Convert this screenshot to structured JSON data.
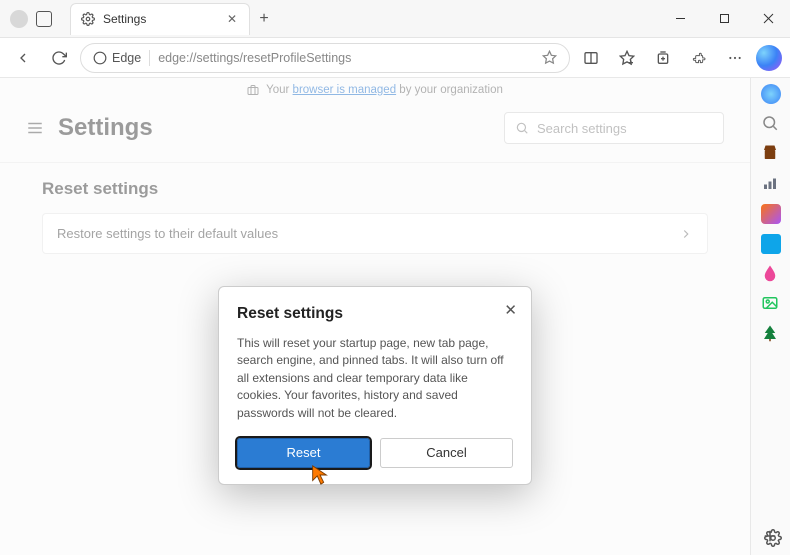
{
  "titlebar": {
    "tab_title": "Settings",
    "newtab_tooltip": "New tab"
  },
  "toolbar": {
    "edge_label": "Edge",
    "url": "edge://settings/resetProfileSettings"
  },
  "managed": {
    "prefix": "Your ",
    "link": "browser is managed",
    "suffix": " by your organization"
  },
  "settings": {
    "title": "Settings",
    "search_placeholder": "Search settings",
    "section_title": "Reset settings",
    "row_label": "Restore settings to their default values"
  },
  "dialog": {
    "title": "Reset settings",
    "body": "This will reset your startup page, new tab page, search engine, and pinned tabs. It will also turn off all extensions and clear temporary data like cookies. Your favorites, history and saved passwords will not be cleared.",
    "reset": "Reset",
    "cancel": "Cancel"
  },
  "sidebar_icons": [
    {
      "name": "copilot-ico",
      "color": "#3b82f6"
    },
    {
      "name": "wand-ico",
      "color": "#a855f7"
    },
    {
      "name": "shopping-ico",
      "color": "#7c3e10"
    },
    {
      "name": "games-ico",
      "color": "#6b7280"
    },
    {
      "name": "m365-ico",
      "color": "#7e22ce"
    },
    {
      "name": "outlook-ico",
      "color": "#0ea5e9"
    },
    {
      "name": "drop-ico",
      "color": "#ec4899"
    },
    {
      "name": "image-ico",
      "color": "#22c55e"
    },
    {
      "name": "tree-ico",
      "color": "#15803d"
    }
  ]
}
